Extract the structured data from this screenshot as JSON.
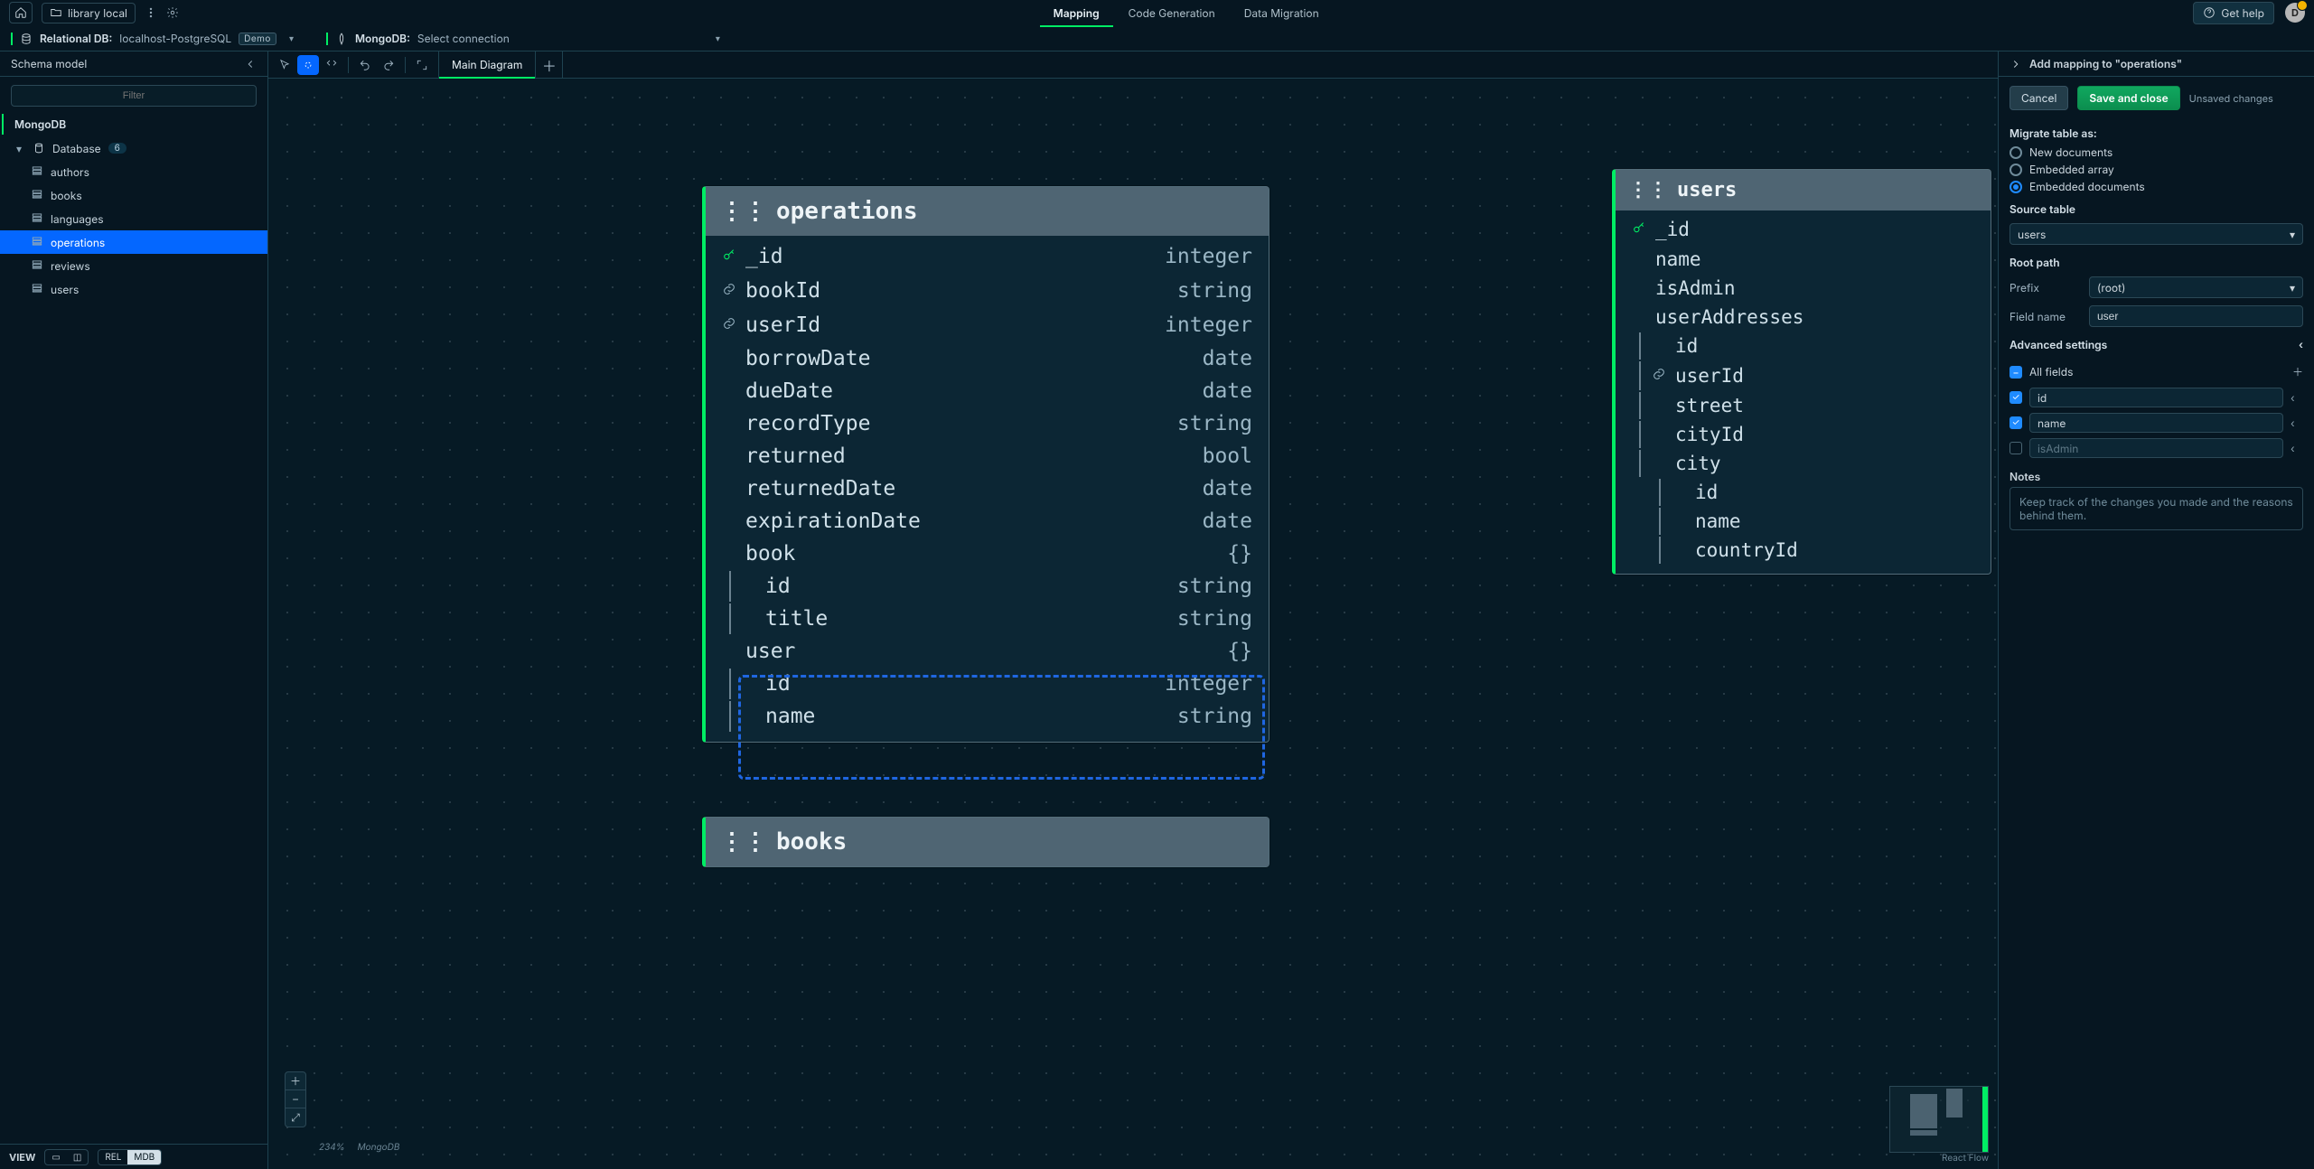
{
  "titlebar": {
    "project_name": "library local",
    "tabs": {
      "mapping": "Mapping",
      "codegen": "Code Generation",
      "migration": "Data Migration"
    },
    "help_label": "Get help",
    "avatar_letter": "D"
  },
  "connbar": {
    "rel_label": "Relational DB:",
    "rel_value": "localhost-PostgreSQL",
    "rel_badge": "Demo",
    "mongo_label": "MongoDB:",
    "mongo_value": "Select connection"
  },
  "sidebar": {
    "title": "Schema model",
    "filter_placeholder": "Filter",
    "section": "MongoDB",
    "root_label": "Database",
    "root_count": "6",
    "items": [
      "authors",
      "books",
      "languages",
      "operations",
      "reviews",
      "users"
    ],
    "active_index": 3,
    "footer": {
      "view_label": "VIEW",
      "rel": "REL",
      "mdb": "MDB"
    }
  },
  "tabs": {
    "main_diagram": "Main Diagram"
  },
  "canvas_status": {
    "zoom": "234%",
    "driver": "MongoDB",
    "rf": "React Flow"
  },
  "nodes": {
    "operations": {
      "title": "operations",
      "fields": [
        {
          "icon": "key",
          "name": "_id",
          "type": "integer"
        },
        {
          "icon": "link",
          "name": "bookId",
          "type": "string"
        },
        {
          "icon": "link",
          "name": "userId",
          "type": "integer"
        },
        {
          "icon": "",
          "name": "borrowDate",
          "type": "date"
        },
        {
          "icon": "",
          "name": "dueDate",
          "type": "date"
        },
        {
          "icon": "",
          "name": "recordType",
          "type": "string"
        },
        {
          "icon": "",
          "name": "returned",
          "type": "bool"
        },
        {
          "icon": "",
          "name": "returnedDate",
          "type": "date"
        },
        {
          "icon": "",
          "name": "expirationDate",
          "type": "date"
        },
        {
          "icon": "",
          "name": "book",
          "type": "{}"
        },
        {
          "icon": "",
          "name": "id",
          "type": "string",
          "indent": 1
        },
        {
          "icon": "",
          "name": "title",
          "type": "string",
          "indent": 1
        },
        {
          "icon": "",
          "name": "user",
          "type": "{}"
        },
        {
          "icon": "",
          "name": "id",
          "type": "integer",
          "indent": 1
        },
        {
          "icon": "",
          "name": "name",
          "type": "string",
          "indent": 1
        }
      ]
    },
    "users": {
      "title": "users",
      "fields": [
        {
          "icon": "key",
          "name": "_id"
        },
        {
          "icon": "",
          "name": "name"
        },
        {
          "icon": "",
          "name": "isAdmin"
        },
        {
          "icon": "",
          "name": "userAddresses"
        },
        {
          "icon": "",
          "name": "id",
          "indent": 1
        },
        {
          "icon": "link",
          "name": "userId",
          "indent": 1
        },
        {
          "icon": "",
          "name": "street",
          "indent": 1
        },
        {
          "icon": "",
          "name": "cityId",
          "indent": 1
        },
        {
          "icon": "",
          "name": "city",
          "indent": 1
        },
        {
          "icon": "",
          "name": "id",
          "indent": 2
        },
        {
          "icon": "",
          "name": "name",
          "indent": 2
        },
        {
          "icon": "",
          "name": "countryId",
          "indent": 2
        }
      ]
    },
    "books": {
      "title": "books"
    }
  },
  "rightpane": {
    "title": "Add mapping to \"operations\"",
    "cancel": "Cancel",
    "save": "Save and close",
    "unsaved": "Unsaved changes",
    "migrate_label": "Migrate table as:",
    "opt_new": "New documents",
    "opt_arr": "Embedded array",
    "opt_doc": "Embedded documents",
    "source_label": "Source table",
    "source_value": "users",
    "root_label": "Root path",
    "prefix_label": "Prefix",
    "prefix_value": "(root)",
    "fieldname_label": "Field name",
    "fieldname_value": "user",
    "advanced_label": "Advanced settings",
    "allfields_label": "All fields",
    "fields": [
      {
        "name": "id",
        "checked": true
      },
      {
        "name": "name",
        "checked": true
      },
      {
        "name": "isAdmin",
        "checked": false
      }
    ],
    "notes_label": "Notes",
    "notes_placeholder": "Keep track of the changes you made and the reasons behind them."
  }
}
